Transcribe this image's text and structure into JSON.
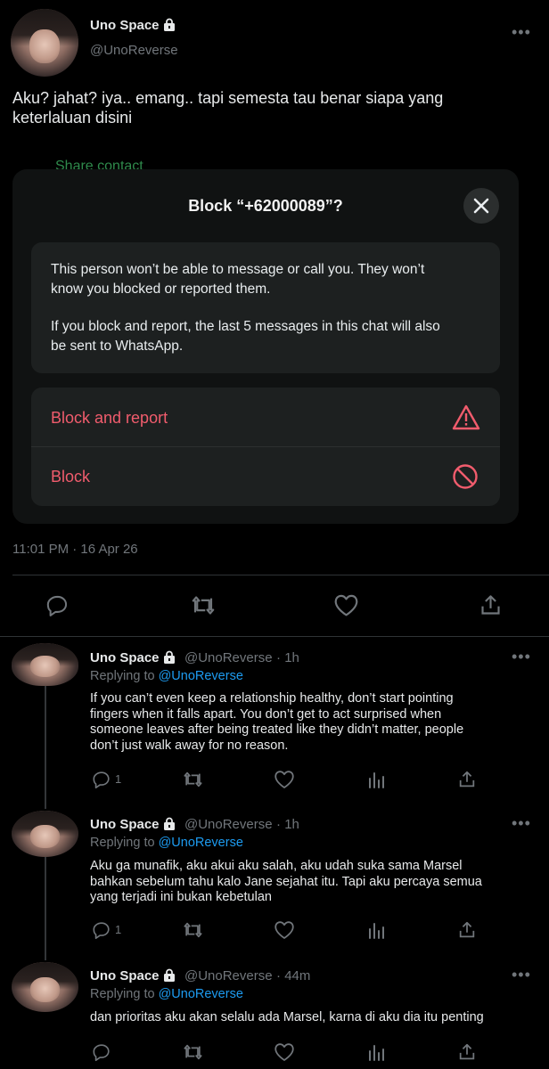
{
  "main_tweet": {
    "name": "Uno Space",
    "handle": "@UnoReverse",
    "text_line1": "Aku? jahat? iya.. emang.. tapi semesta tau benar siapa yang",
    "text_line2": "keterlaluan disini",
    "timestamp": "11:01 PM · 16 Apr 26",
    "behind_text": "Share contact"
  },
  "dialog": {
    "title": "Block “+62000089”?",
    "info_line1": "This person won’t be able to message or call you. They won’t",
    "info_line2": "know you blocked or reported them.",
    "info_line3": "If you block and report, the last 5 messages in this chat will also",
    "info_line4": "be sent to WhatsApp.",
    "action_block_report": "Block and report",
    "action_block": "Block",
    "accent_color": "#f15c6d"
  },
  "replies": [
    {
      "name": "Uno Space",
      "handle": "@UnoReverse",
      "time": "· 1h",
      "replying_prefix": "Replying to",
      "replying_to": "@UnoReverse",
      "line1": "If you can’t even keep a relationship healthy, don’t start pointing",
      "line2": "fingers when it falls apart. You don’t get to act surprised when",
      "line3": "someone leaves after being treated like they didn’t matter, people",
      "line4": "don’t just walk away for no reason.",
      "reply_count": "1"
    },
    {
      "name": "Uno Space",
      "handle": "@UnoReverse",
      "time": "· 1h",
      "replying_prefix": "Replying to",
      "replying_to": "@UnoReverse",
      "line1": "Aku ga munafik, aku akui aku salah, aku udah suka sama Marsel",
      "line2": "bahkan sebelum tahu kalo Jane sejahat itu. Tapi aku percaya semua",
      "line3": "yang terjadi ini bukan kebetulan",
      "reply_count": "1"
    },
    {
      "name": "Uno Space",
      "handle": "@UnoReverse",
      "time": "· 44m",
      "replying_prefix": "Replying to",
      "replying_to": "@UnoReverse",
      "line1": "dan prioritas aku akan selalu ada Marsel, karna di aku dia itu penting"
    }
  ],
  "more_label": "•••",
  "colors": {
    "link": "#1d9bf0",
    "muted": "#71767b",
    "background": "#000000"
  }
}
